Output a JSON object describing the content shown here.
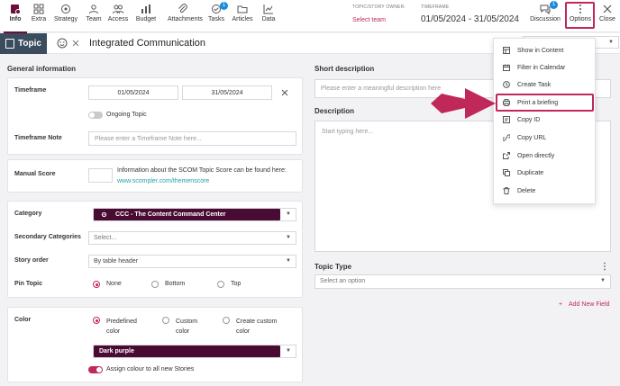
{
  "toolbar": {
    "items": [
      {
        "label": "Info",
        "icon": "info-icon"
      },
      {
        "label": "Extra",
        "icon": "grid-icon"
      },
      {
        "label": "Strategy",
        "icon": "target-icon"
      },
      {
        "label": "Team",
        "icon": "team-icon"
      },
      {
        "label": "Access",
        "icon": "people-icon"
      },
      {
        "label": "Budget",
        "icon": "budget-icon"
      },
      {
        "label": "Attachments",
        "icon": "paperclip-icon"
      },
      {
        "label": "Tasks",
        "icon": "check-icon",
        "badge": "1"
      },
      {
        "label": "Articles",
        "icon": "folder-icon"
      },
      {
        "label": "Data",
        "icon": "chart-icon"
      }
    ],
    "owner_label": "TOPIC/STORY OWNER:",
    "owner_value": "Select team",
    "timeframe_label": "TIMEFRAME",
    "timeframe_value": "01/05/2024 - 31/05/2024",
    "discussion_label": "Discussion",
    "discussion_badge": "1",
    "options_label": "Options",
    "close_label": "Close"
  },
  "titlebar": {
    "tab_label": "Topic",
    "title": "Integrated Communication"
  },
  "general": {
    "title": "General information",
    "timeframe_label": "Timeframe",
    "start_date": "01/05/2024",
    "end_date": "31/05/2024",
    "ongoing_label": "Ongoing Topic",
    "note_label": "Timeframe Note",
    "note_placeholder": "Please enter a Timeframe Note here...",
    "manual_score_label": "Manual Score",
    "score_info": "Information about the SCOM Topic Score can be found here:",
    "score_link": "www.scompler.com/themenscore",
    "category_label": "Category",
    "category_value": "CCC - The Content Command Center",
    "secondary_label": "Secondary Categories",
    "secondary_placeholder": "Select...",
    "story_order_label": "Story order",
    "story_order_value": "By table header",
    "pin_label": "Pin Topic",
    "pin_options": [
      "None",
      "Bottom",
      "Top"
    ],
    "color_label": "Color",
    "color_options": [
      "Predefined color",
      "Custom color",
      "Create custom color"
    ],
    "color_value": "Dark purple",
    "assign_colour_label": "Assign colour to all new Stories"
  },
  "right": {
    "short_desc_title": "Short description",
    "short_desc_placeholder": "Please enter a meaningful description here",
    "desc_title": "Description",
    "desc_placeholder": "Start typing here...",
    "topic_type_title": "Topic Type",
    "topic_type_placeholder": "Select an option",
    "add_field": "Add New Field"
  },
  "menu": {
    "items": [
      {
        "label": "Show in Content",
        "icon": "content-icon"
      },
      {
        "label": "Filter in Calendar",
        "icon": "calendar-icon"
      },
      {
        "label": "Create Task",
        "icon": "clock-icon"
      },
      {
        "label": "Print a briefing",
        "icon": "printer-icon"
      },
      {
        "label": "Copy ID",
        "icon": "copy-id-icon"
      },
      {
        "label": "Copy URL",
        "icon": "link-icon"
      },
      {
        "label": "Open directly",
        "icon": "external-icon"
      },
      {
        "label": "Duplicate",
        "icon": "duplicate-icon"
      },
      {
        "label": "Delete",
        "icon": "trash-icon"
      }
    ]
  },
  "colors": {
    "accent": "#c0285a",
    "brand_dark": "#4a0b32",
    "header_tab": "#3a4c5e",
    "link": "#2aa0a8"
  }
}
